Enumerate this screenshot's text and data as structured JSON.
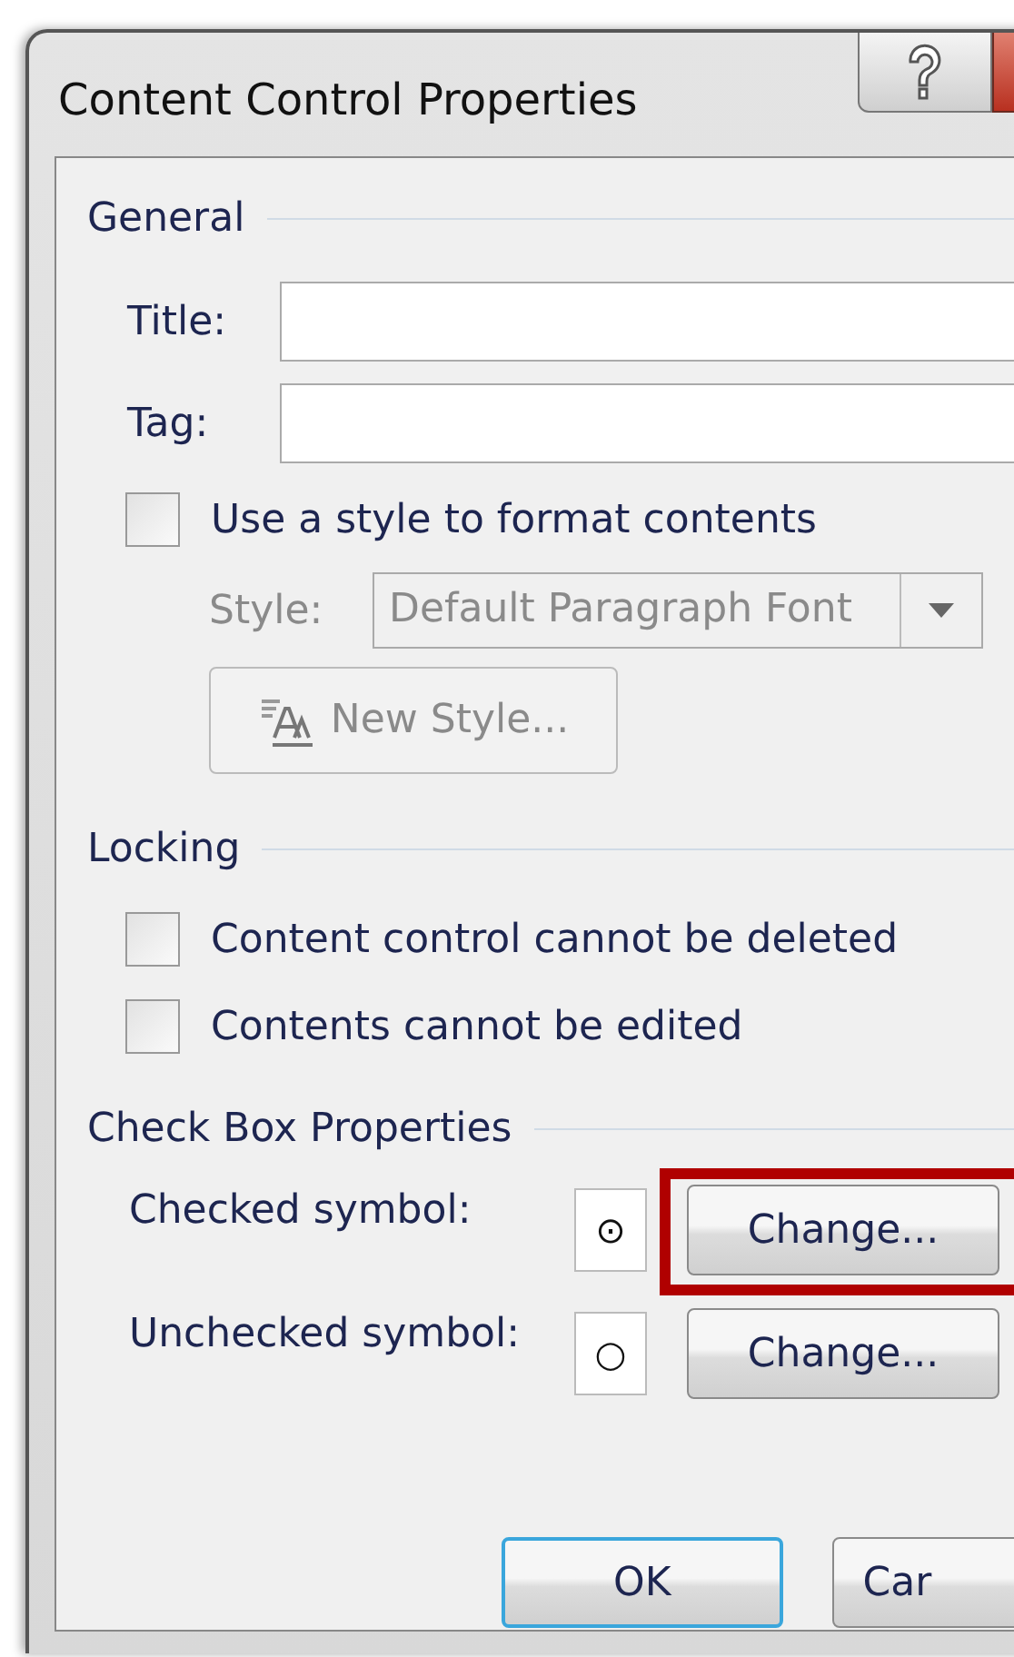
{
  "window": {
    "title": "Content Control Properties"
  },
  "general": {
    "heading": "General",
    "fields": [
      {
        "label": "Title:"
      },
      {
        "label": "Tag:"
      }
    ],
    "use_style": {
      "label": "Use a style to format contents",
      "checked": false
    },
    "style": {
      "label": "Style:",
      "value": "Default Paragraph Font",
      "disabled": true
    },
    "new_style_button": {
      "label": "New Style...",
      "disabled": true
    }
  },
  "locking": {
    "heading": "Locking",
    "options": [
      {
        "label": "Content control cannot be deleted",
        "checked": false
      },
      {
        "label": "Contents cannot be edited",
        "checked": false
      }
    ]
  },
  "check_box_properties": {
    "heading": "Check Box Properties",
    "rows": [
      {
        "label": "Checked symbol:",
        "symbol": "⊙",
        "button": "Change...",
        "highlighted": true
      },
      {
        "label": "Unchecked symbol:",
        "symbol": "○",
        "button": "Change...",
        "highlighted": false
      }
    ]
  },
  "buttons": [
    {
      "label": "OK",
      "default": true
    },
    {
      "label": "Car",
      "default": false
    }
  ]
}
